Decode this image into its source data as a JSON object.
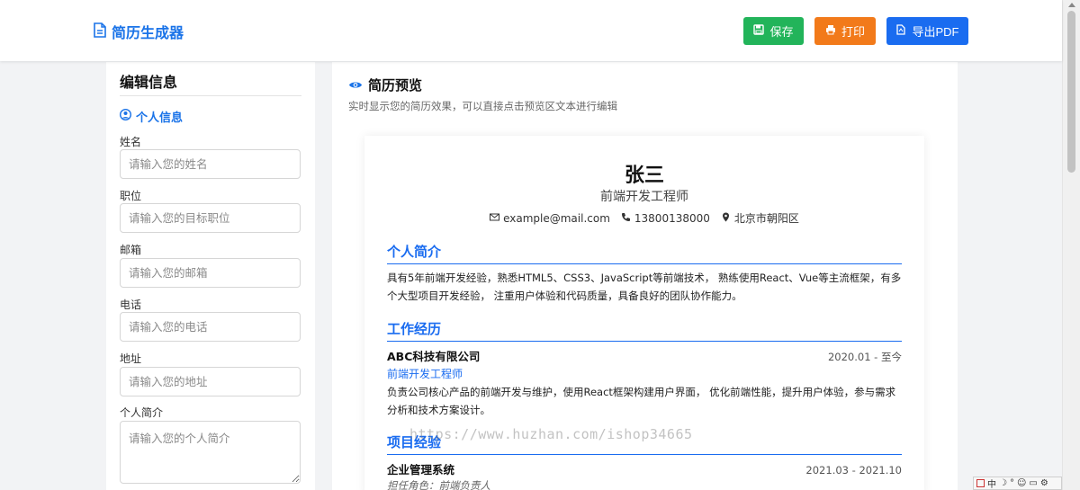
{
  "header": {
    "brand": "简历生成器",
    "save_label": "保存",
    "print_label": "打印",
    "pdf_label": "导出PDF"
  },
  "colors": {
    "accent": "#1a73e8",
    "save": "#22b45a",
    "print": "#f27a1a",
    "pdf": "#1a6cf0"
  },
  "editor": {
    "title": "编辑信息",
    "section": "个人信息",
    "fields": [
      {
        "label": "姓名",
        "placeholder": "请输入您的姓名"
      },
      {
        "label": "职位",
        "placeholder": "请输入您的目标职位"
      },
      {
        "label": "邮箱",
        "placeholder": "请输入您的邮箱"
      },
      {
        "label": "电话",
        "placeholder": "请输入您的电话"
      },
      {
        "label": "地址",
        "placeholder": "请输入您的地址"
      },
      {
        "label": "个人简介",
        "placeholder": "请输入您的个人简介"
      }
    ]
  },
  "preview": {
    "title": "简历预览",
    "subtitle": "实时显示您的简历效果，可以直接点击预览区文本进行编辑"
  },
  "resume": {
    "name": "张三",
    "title": "前端开发工程师",
    "email": "example@mail.com",
    "phone": "13800138000",
    "location": "北京市朝阳区",
    "summary_title": "个人简介",
    "summary": "具有5年前端开发经验，熟悉HTML5、CSS3、JavaScript等前端技术， 熟练使用React、Vue等主流框架，有多个大型项目开发经验， 注重用户体验和代码质量，具备良好的团队协作能力。",
    "work_title": "工作经历",
    "work": {
      "company": "ABC科技有限公司",
      "date": "2020.01 - 至今",
      "role": "前端开发工程师",
      "desc": "负责公司核心产品的前端开发与维护，使用React框架构建用户界面， 优化前端性能，提升用户体验，参与需求分析和技术方案设计。"
    },
    "project_title": "项目经验",
    "project": {
      "name": "企业管理系统",
      "date": "2021.03 - 2021.10",
      "role": "担任角色：前端负责人"
    }
  },
  "watermark": "https://www.huzhan.com/ishop34665",
  "tray": [
    "中"
  ]
}
